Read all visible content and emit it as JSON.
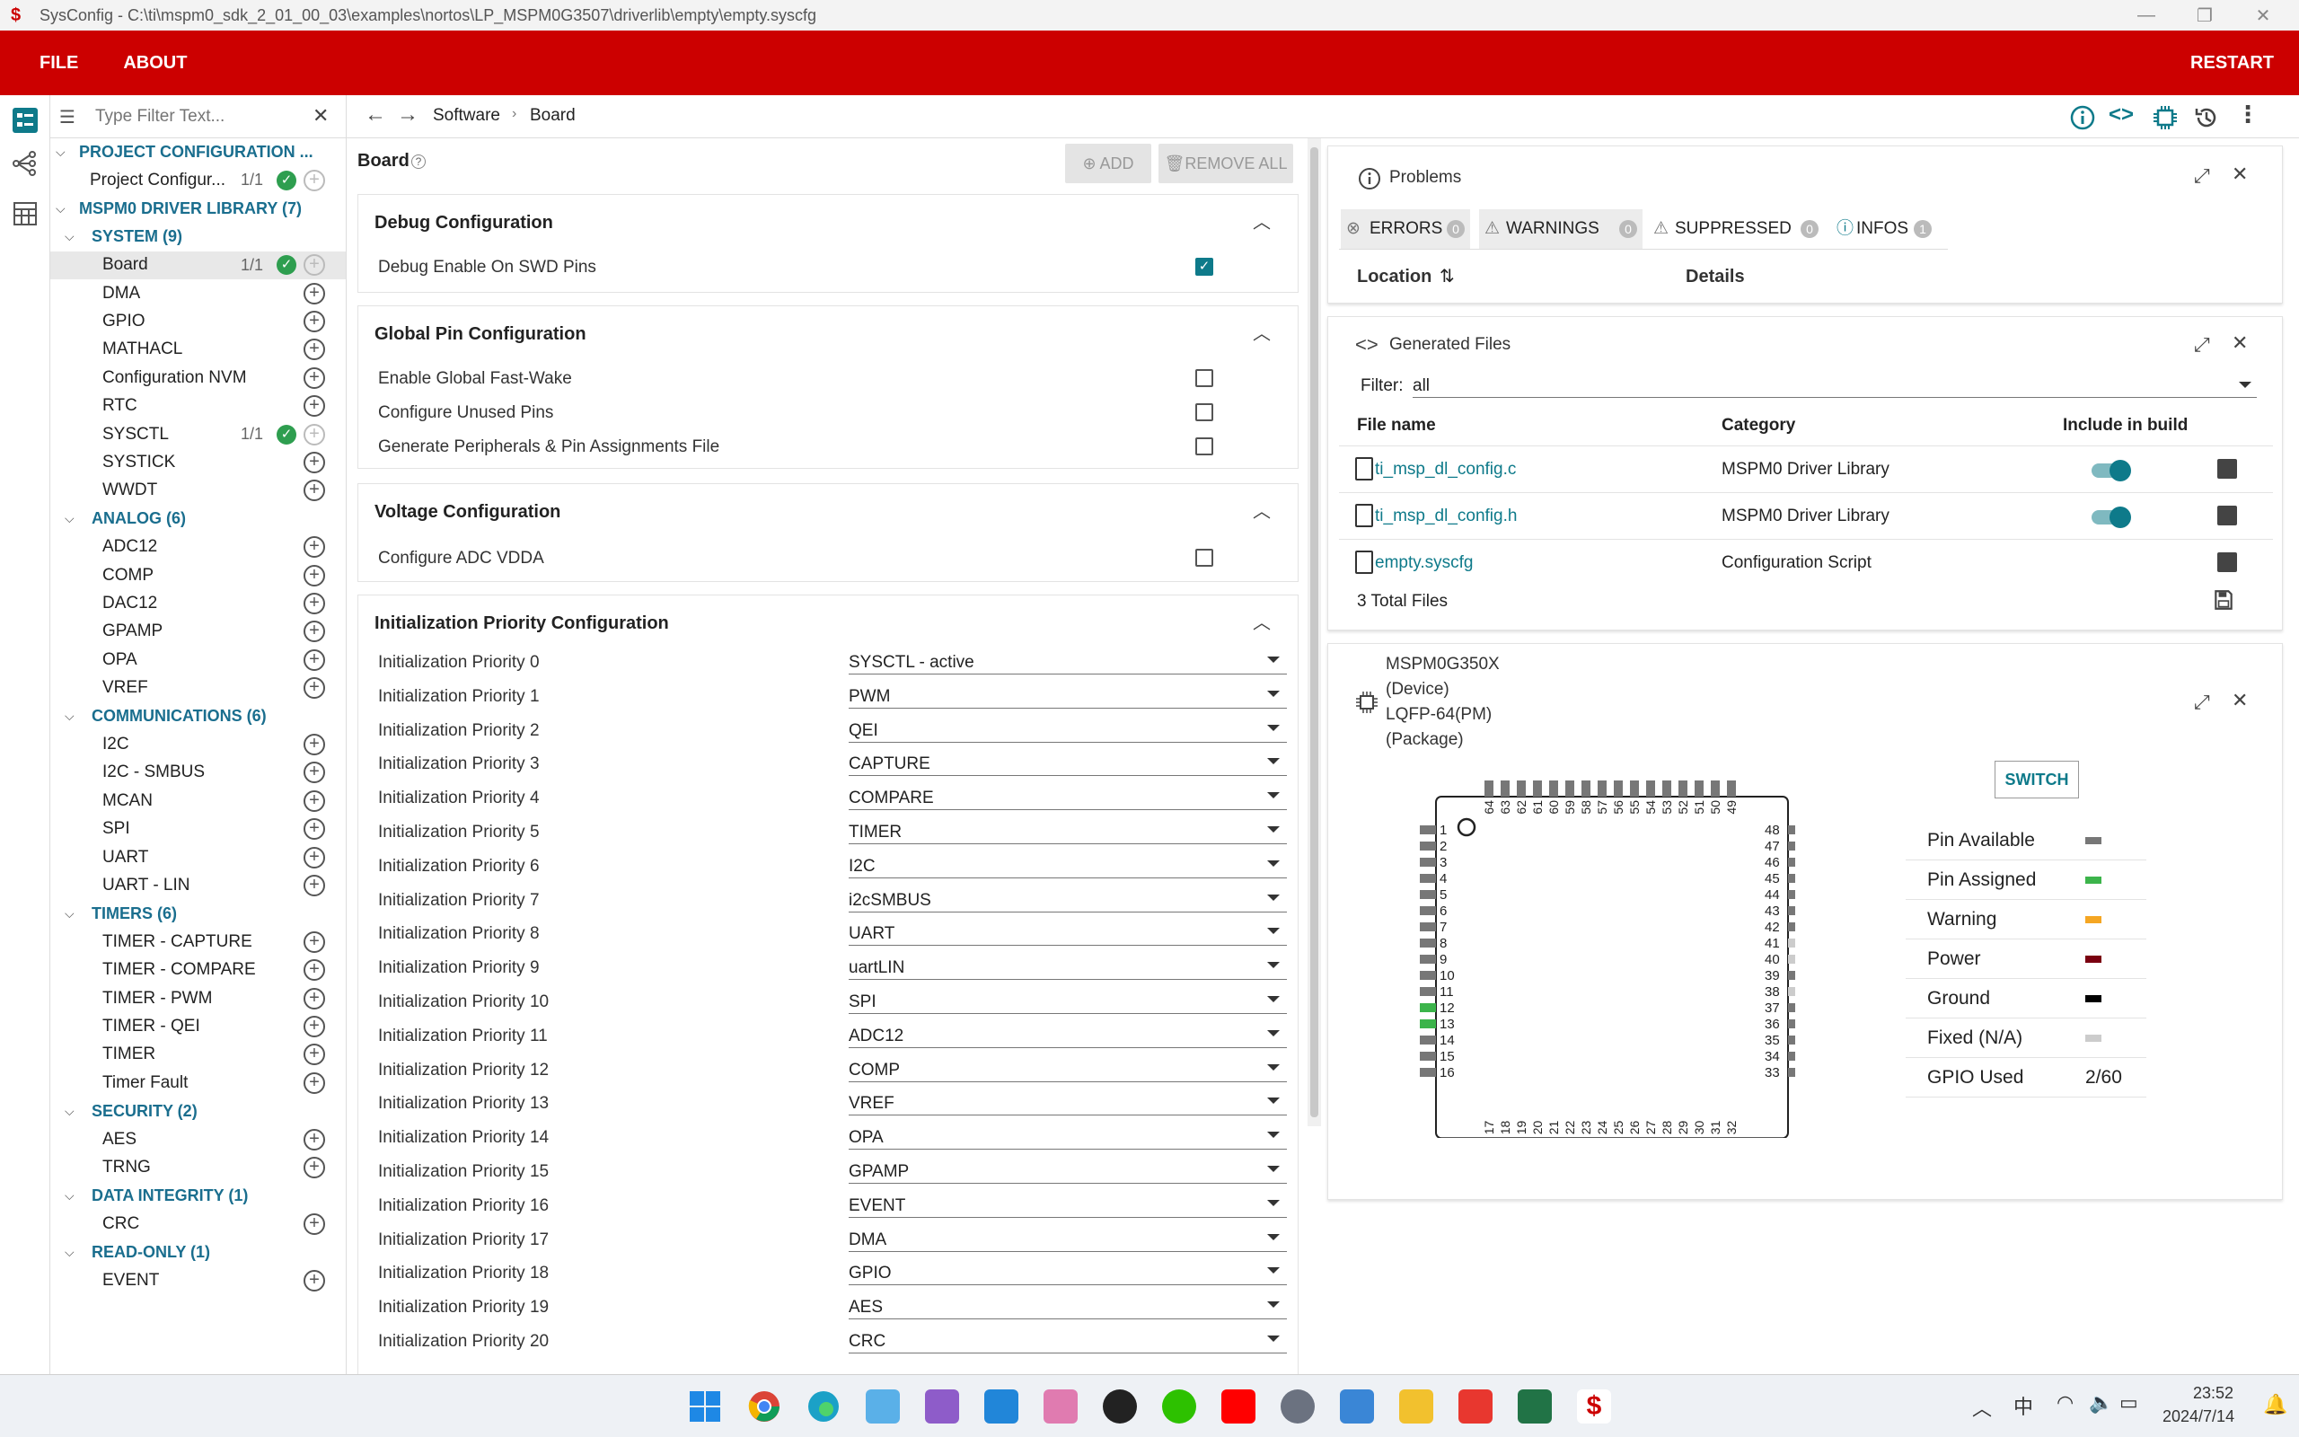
{
  "window": {
    "title": "SysConfig - C:\\ti\\mspm0_sdk_2_01_00_03\\examples\\nortos\\LP_MSPM0G3507\\driverlib\\empty\\empty.syscfg"
  },
  "menu": {
    "file": "FILE",
    "about": "ABOUT",
    "restart": "RESTART"
  },
  "filter": {
    "placeholder": "Type Filter Text..."
  },
  "breadcrumb": {
    "root": "Software",
    "current": "Board"
  },
  "tree": {
    "project_config": "PROJECT CONFIGURATION ...",
    "project_config_item": "Project Configur...",
    "project_config_count": "1/1",
    "driver_lib": "MSPM0 DRIVER LIBRARY (7)",
    "categories": [
      {
        "label": "SYSTEM (9)",
        "items": [
          {
            "label": "Board",
            "count": "1/1",
            "ok": true,
            "selected": true
          },
          {
            "label": "DMA"
          },
          {
            "label": "GPIO"
          },
          {
            "label": "MATHACL"
          },
          {
            "label": "Configuration NVM"
          },
          {
            "label": "RTC"
          },
          {
            "label": "SYSCTL",
            "count": "1/1",
            "ok": true
          },
          {
            "label": "SYSTICK"
          },
          {
            "label": "WWDT"
          }
        ]
      },
      {
        "label": "ANALOG (6)",
        "items": [
          {
            "label": "ADC12"
          },
          {
            "label": "COMP"
          },
          {
            "label": "DAC12"
          },
          {
            "label": "GPAMP"
          },
          {
            "label": "OPA"
          },
          {
            "label": "VREF"
          }
        ]
      },
      {
        "label": "COMMUNICATIONS (6)",
        "items": [
          {
            "label": "I2C"
          },
          {
            "label": "I2C - SMBUS"
          },
          {
            "label": "MCAN"
          },
          {
            "label": "SPI"
          },
          {
            "label": "UART"
          },
          {
            "label": "UART - LIN"
          }
        ]
      },
      {
        "label": "TIMERS (6)",
        "items": [
          {
            "label": "TIMER - CAPTURE"
          },
          {
            "label": "TIMER - COMPARE"
          },
          {
            "label": "TIMER - PWM"
          },
          {
            "label": "TIMER - QEI"
          },
          {
            "label": "TIMER"
          },
          {
            "label": "Timer Fault"
          }
        ]
      },
      {
        "label": "SECURITY (2)",
        "items": [
          {
            "label": "AES"
          },
          {
            "label": "TRNG"
          }
        ]
      },
      {
        "label": "DATA INTEGRITY (1)",
        "items": [
          {
            "label": "CRC"
          }
        ]
      },
      {
        "label": "READ-ONLY (1)",
        "items": [
          {
            "label": "EVENT"
          }
        ]
      }
    ]
  },
  "board": {
    "title": "Board",
    "help": "?",
    "add": "ADD",
    "remove_all": "REMOVE ALL",
    "debug": {
      "title": "Debug Configuration",
      "swd_label": "Debug Enable On SWD Pins",
      "swd_checked": true
    },
    "global_pin": {
      "title": "Global Pin Configuration",
      "fast_wake": "Enable Global Fast-Wake",
      "unused_pins": "Configure Unused Pins",
      "gen_file": "Generate Peripherals & Pin Assignments File"
    },
    "voltage": {
      "title": "Voltage Configuration",
      "adc_vdda": "Configure ADC VDDA"
    },
    "init": {
      "title": "Initialization Priority Configuration",
      "rows": [
        {
          "label": "Initialization Priority 0",
          "value": "SYSCTL - active"
        },
        {
          "label": "Initialization Priority 1",
          "value": "PWM"
        },
        {
          "label": "Initialization Priority 2",
          "value": "QEI"
        },
        {
          "label": "Initialization Priority 3",
          "value": "CAPTURE"
        },
        {
          "label": "Initialization Priority 4",
          "value": "COMPARE"
        },
        {
          "label": "Initialization Priority 5",
          "value": "TIMER"
        },
        {
          "label": "Initialization Priority 6",
          "value": "I2C"
        },
        {
          "label": "Initialization Priority 7",
          "value": "i2cSMBUS"
        },
        {
          "label": "Initialization Priority 8",
          "value": "UART"
        },
        {
          "label": "Initialization Priority 9",
          "value": "uartLIN"
        },
        {
          "label": "Initialization Priority 10",
          "value": "SPI"
        },
        {
          "label": "Initialization Priority 11",
          "value": "ADC12"
        },
        {
          "label": "Initialization Priority 12",
          "value": "COMP"
        },
        {
          "label": "Initialization Priority 13",
          "value": "VREF"
        },
        {
          "label": "Initialization Priority 14",
          "value": "OPA"
        },
        {
          "label": "Initialization Priority 15",
          "value": "GPAMP"
        },
        {
          "label": "Initialization Priority 16",
          "value": "EVENT"
        },
        {
          "label": "Initialization Priority 17",
          "value": "DMA"
        },
        {
          "label": "Initialization Priority 18",
          "value": "GPIO"
        },
        {
          "label": "Initialization Priority 19",
          "value": "AES"
        },
        {
          "label": "Initialization Priority 20",
          "value": "CRC"
        }
      ]
    }
  },
  "problems": {
    "title": "Problems",
    "errors": "ERRORS",
    "errors_count": "0",
    "warnings": "WARNINGS",
    "warnings_count": "0",
    "suppressed": "SUPPRESSED",
    "suppressed_count": "0",
    "infos": "INFOS",
    "infos_count": "1",
    "col_location": "Location",
    "col_details": "Details"
  },
  "generated": {
    "title": "Generated Files",
    "filter_label": "Filter:",
    "filter_value": "all",
    "col_file": "File name",
    "col_category": "Category",
    "col_include": "Include in build",
    "files": [
      {
        "name": "ti_msp_dl_config.c",
        "category": "MSPM0 Driver Library",
        "include": true
      },
      {
        "name": "ti_msp_dl_config.h",
        "category": "MSPM0 Driver Library",
        "include": true
      },
      {
        "name": "empty.syscfg",
        "category": "Configuration Script",
        "include": false
      }
    ],
    "total": "3 Total Files"
  },
  "device": {
    "name": "MSPM0G350X",
    "device_label": "(Device)",
    "package": "LQFP-64(PM)",
    "package_label": "(Package)",
    "switch": "SWITCH",
    "legend": [
      {
        "label": "Pin Available",
        "color": "#777777"
      },
      {
        "label": "Pin Assigned",
        "color": "#3cb44b"
      },
      {
        "label": "Warning",
        "color": "#f5a623"
      },
      {
        "label": "Power",
        "color": "#7a0010"
      },
      {
        "label": "Ground",
        "color": "#000000"
      },
      {
        "label": "Fixed (N/A)",
        "color": "#cccccc"
      },
      {
        "label": "GPIO Used",
        "value": "2/60"
      }
    ]
  },
  "taskbar": {
    "time": "23:52",
    "date": "2024/7/14",
    "ime": "中"
  },
  "colors": {
    "brand_red": "#cc0000",
    "accent_teal": "#0e7a8a",
    "link": "#0e7a8a"
  }
}
